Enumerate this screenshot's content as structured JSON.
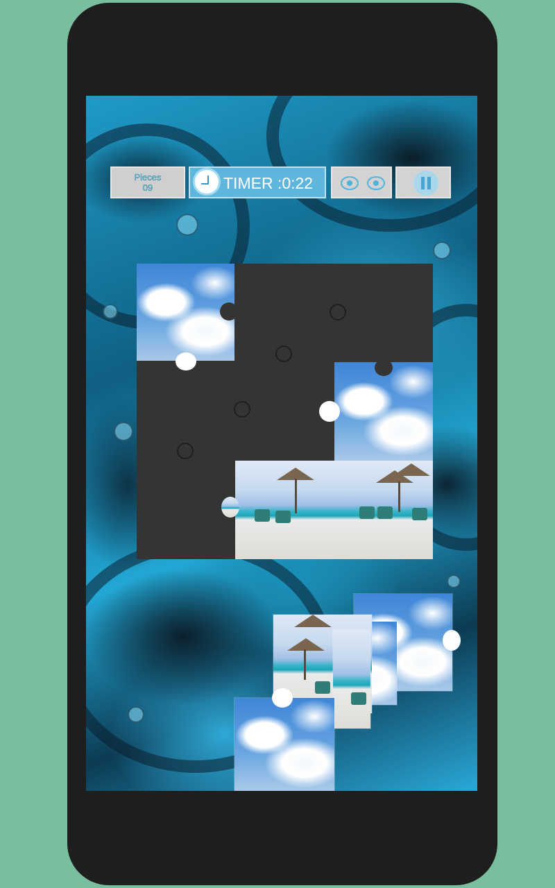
{
  "hud": {
    "pieces_label": "Pieces",
    "pieces_count": "09",
    "timer_text": "TIMER :0:22",
    "hint_icon": "eyes-icon",
    "pause_icon": "pause-icon",
    "clock_icon": "clock-icon"
  },
  "puzzle": {
    "grid": "3x3",
    "placed_pieces": 4,
    "loose_pieces": 5,
    "image_theme": "beach with umbrellas, chairs and cloudy sky"
  },
  "colors": {
    "background": "#79bf9f",
    "phone": "#1e1e1e",
    "board": "#343432",
    "timer_bg": "#5fb6dc",
    "hud_text": "#4fc6e6"
  }
}
